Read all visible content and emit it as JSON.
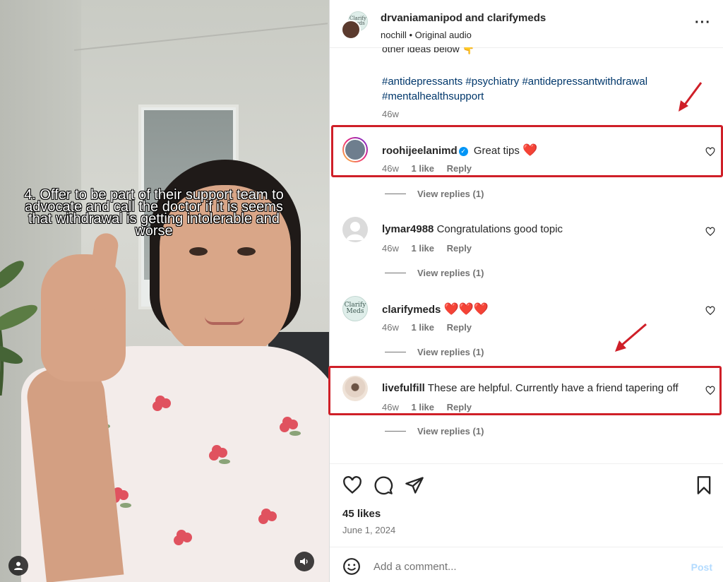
{
  "video": {
    "overlay_text": "4. Offer to be part of their support team to advocate and call the doctor if it is seems that withdrawal is getting intolerable and worse"
  },
  "header": {
    "title": "drvaniamanipod and clarifymeds",
    "audio": "nochill • Original audio",
    "more_icon": "more-horizontal-icon",
    "clarify_avatar_text": "Clarify Meds"
  },
  "post": {
    "caption_fragment": "other ideas below 👇",
    "hashtags": "#antidepressants #psychiatry #antidepressantwithdrawal #mentalhealthsupport",
    "time": "46w"
  },
  "comments": [
    {
      "user": "roohijeelanimd",
      "verified": true,
      "text": "Great tips",
      "emoji": "❤️",
      "time": "46w",
      "likes": "1 like",
      "reply": "Reply",
      "view_replies": "View replies (1)"
    },
    {
      "user": "lymar4988",
      "verified": false,
      "text": "Congratulations good topic",
      "emoji": "",
      "time": "46w",
      "likes": "1 like",
      "reply": "Reply",
      "view_replies": "View replies (1)"
    },
    {
      "user": "clarifymeds",
      "verified": false,
      "text": "",
      "emoji": "❤️❤️❤️",
      "time": "46w",
      "likes": "1 like",
      "reply": "Reply",
      "view_replies": "View replies (1)"
    },
    {
      "user": "livefulfill",
      "verified": false,
      "text": "These are helpful. Currently have a friend tapering off",
      "emoji": "",
      "time": "46w",
      "likes": "1 like",
      "reply": "Reply",
      "view_replies": "View replies (1)"
    }
  ],
  "actions": {
    "likes": "45 likes",
    "date": "June 1, 2024"
  },
  "composer": {
    "placeholder": "Add a comment...",
    "post_label": "Post"
  },
  "colors": {
    "highlight": "#cf1f28",
    "hashtag": "#00376b",
    "verified": "#0095f6"
  }
}
